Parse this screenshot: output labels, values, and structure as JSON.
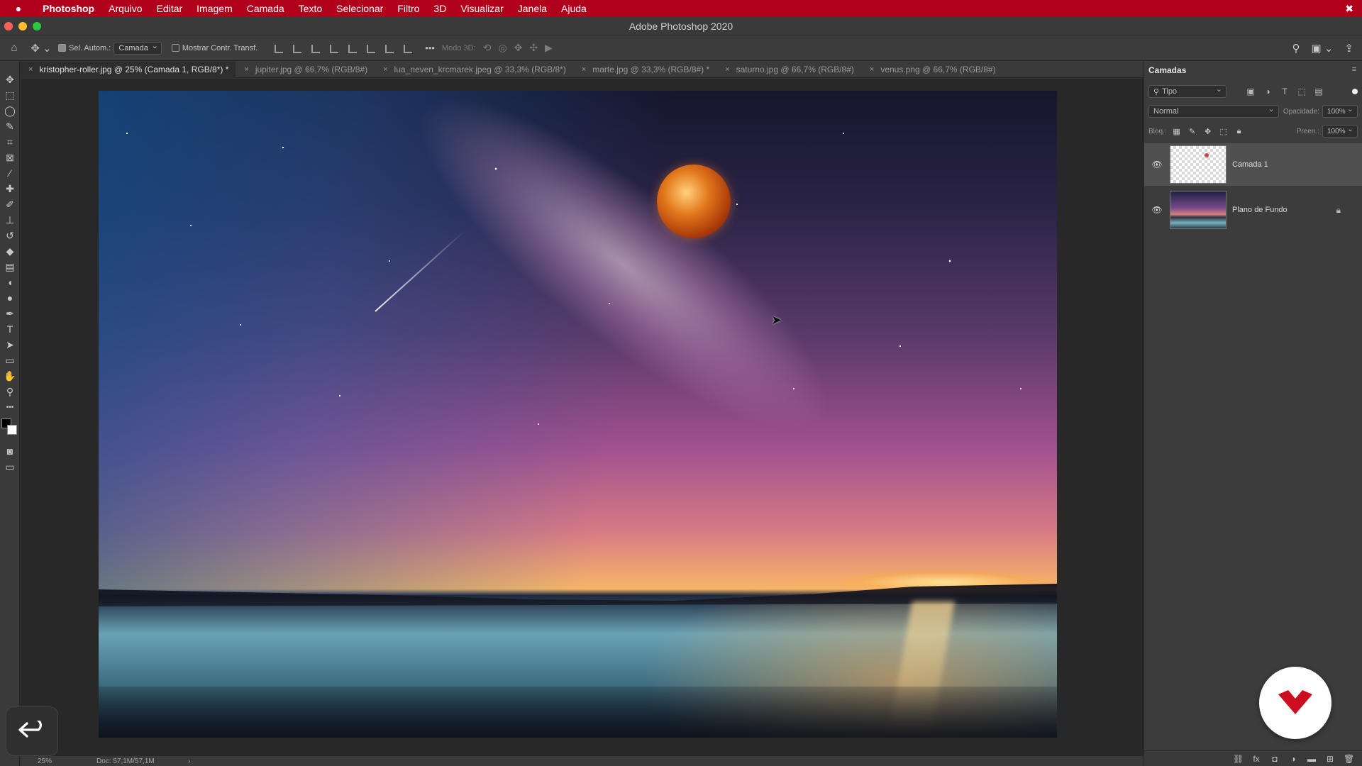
{
  "menubar": {
    "items": [
      "Photoshop",
      "Arquivo",
      "Editar",
      "Imagem",
      "Camada",
      "Texto",
      "Selecionar",
      "Filtro",
      "3D",
      "Visualizar",
      "Janela",
      "Ajuda"
    ],
    "apple_icon": "apple-icon",
    "right_icon": "creative-cloud-icon"
  },
  "window": {
    "title": "Adobe Photoshop 2020",
    "traffic_colors": [
      "#ff5f57",
      "#febc2e",
      "#28c840"
    ]
  },
  "options": {
    "auto_select_label": "Sel. Autom.:",
    "auto_select_checked": true,
    "auto_select_target": "Camada",
    "show_transform_label": "Mostrar Contr. Transf.",
    "show_transform_checked": false,
    "mode_3d_label": "Modo 3D:",
    "more_label": "•••"
  },
  "tabs": [
    {
      "label": "kristopher-roller.jpg @ 25% (Camada 1, RGB/8*) *",
      "active": true
    },
    {
      "label": "jupiter.jpg @ 66,7% (RGB/8#)",
      "active": false
    },
    {
      "label": "lua_neven_krcmarek.jpeg @ 33,3% (RGB/8*)",
      "active": false
    },
    {
      "label": "marte.jpg @ 33,3% (RGB/8#) *",
      "active": false
    },
    {
      "label": "saturno.jpg @ 66,7% (RGB/8#)",
      "active": false
    },
    {
      "label": "venus.png @ 66,7% (RGB/8#)",
      "active": false
    }
  ],
  "tools": [
    {
      "name": "move-tool",
      "glyph": "✥"
    },
    {
      "name": "marquee-tool",
      "glyph": "⬚"
    },
    {
      "name": "lasso-tool",
      "glyph": "◯"
    },
    {
      "name": "quick-select-tool",
      "glyph": "✎"
    },
    {
      "name": "crop-tool",
      "glyph": "⌗"
    },
    {
      "name": "frame-tool",
      "glyph": "⊠"
    },
    {
      "name": "eyedropper-tool",
      "glyph": "⁄"
    },
    {
      "name": "healing-tool",
      "glyph": "✚"
    },
    {
      "name": "brush-tool",
      "glyph": "✐"
    },
    {
      "name": "stamp-tool",
      "glyph": "⊥"
    },
    {
      "name": "history-brush-tool",
      "glyph": "↺"
    },
    {
      "name": "eraser-tool",
      "glyph": "◆"
    },
    {
      "name": "gradient-tool",
      "glyph": "▤"
    },
    {
      "name": "blur-tool",
      "glyph": "◖"
    },
    {
      "name": "dodge-tool",
      "glyph": "●"
    },
    {
      "name": "pen-tool",
      "glyph": "✒"
    },
    {
      "name": "type-tool",
      "glyph": "T"
    },
    {
      "name": "path-select-tool",
      "glyph": "➤"
    },
    {
      "name": "rectangle-tool",
      "glyph": "▭"
    },
    {
      "name": "hand-tool",
      "glyph": "✋"
    },
    {
      "name": "zoom-tool",
      "glyph": "⚲"
    },
    {
      "name": "more-tools",
      "glyph": "•••"
    }
  ],
  "status": {
    "zoom": "25%",
    "doc_info": "Doc: 57,1M/57,1M",
    "arrow": "›"
  },
  "layers_panel": {
    "title": "Camadas",
    "filter_label": "Tipo",
    "blend_mode": "Normal",
    "opacity_label": "Opacidade:",
    "opacity_value": "100%",
    "lock_label": "Bloq.:",
    "fill_label": "Preen.:",
    "fill_value": "100%",
    "layers": [
      {
        "name": "Camada 1",
        "visible": true,
        "selected": true,
        "locked": false
      },
      {
        "name": "Plano de Fundo",
        "visible": true,
        "selected": false,
        "locked": true
      }
    ]
  },
  "colors": {
    "menubar_bg": "#b0001b",
    "panel_bg": "#3c3c3c",
    "brand_red": "#cc0d1f"
  }
}
